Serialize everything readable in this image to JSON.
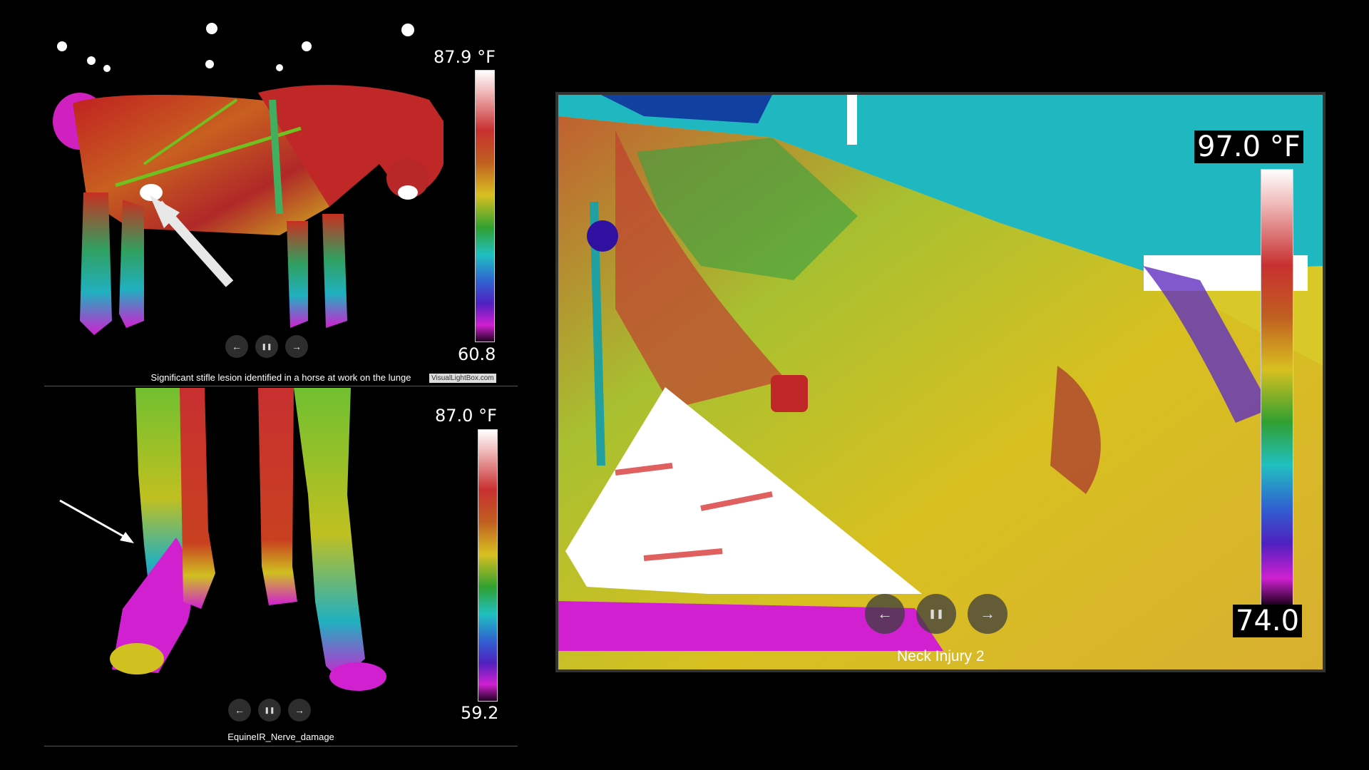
{
  "panel_top": {
    "scale_max": "87.9 °F",
    "scale_min": "60.8",
    "caption": "Significant stifle lesion identified in a horse at work on the lunge",
    "credit": "VisualLightBox.com"
  },
  "panel_bottom": {
    "scale_max": "87.0 °F",
    "scale_min": "59.2",
    "caption": "EquineIR_Nerve_damage"
  },
  "panel_right": {
    "scale_max": "97.0 °F",
    "scale_min": "74.0",
    "caption": "Neck Injury 2"
  },
  "controls": {
    "prev_glyph": "←",
    "pause_glyph": "❚❚",
    "next_glyph": "→"
  }
}
